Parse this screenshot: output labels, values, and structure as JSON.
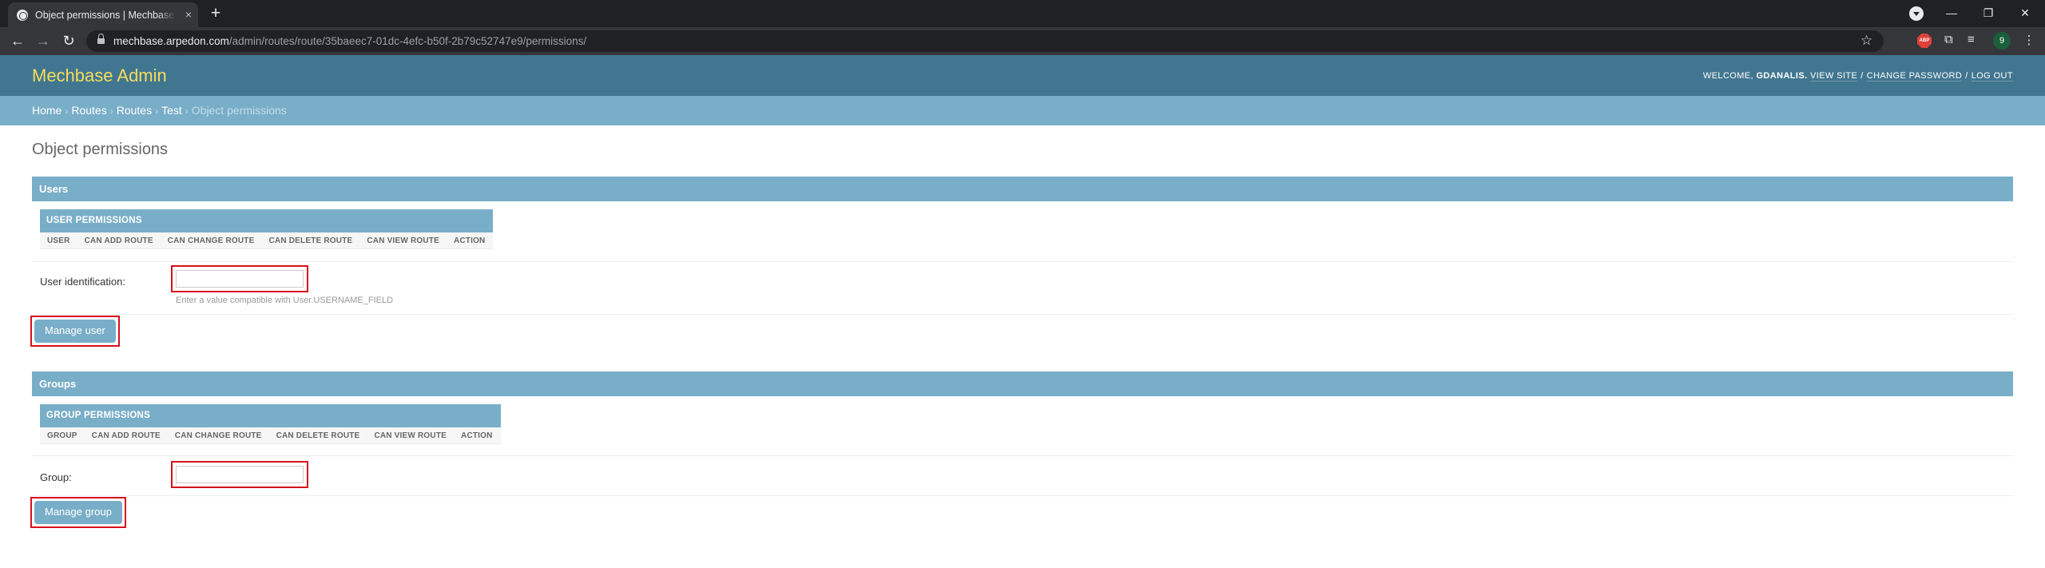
{
  "browser": {
    "tab_title": "Object permissions | Mechbase Admin",
    "new_tab_glyph": "+",
    "url_host": "mechbase.arpedon.com",
    "url_path": "/admin/routes/route/35baeec7-01dc-4efc-b50f-2b79c52747e9/permissions/",
    "profile_initial": "9",
    "abp_label": "ABP",
    "window_controls": {
      "minimize": "—",
      "restore": "❐",
      "close": "✕"
    },
    "nav": {
      "back": "←",
      "forward": "→",
      "reload": "↻"
    },
    "icons": [
      "globe-icon",
      "lock-icon",
      "star-icon",
      "adblock-plus-icon",
      "puzzle-icon",
      "media-queue-icon",
      "kebab-menu-icon"
    ]
  },
  "admin": {
    "site_title": "Mechbase Admin",
    "user_tools": {
      "welcome": "WELCOME,",
      "username": "GDANALIS.",
      "view_site": "VIEW SITE",
      "change_password": "CHANGE PASSWORD",
      "log_out": "LOG OUT",
      "separator": "/"
    },
    "breadcrumbs": [
      "Home",
      "Routes",
      "Routes",
      "Test",
      "Object permissions"
    ],
    "breadcrumb_separator": "›",
    "page_title": "Object permissions",
    "users": {
      "caption": "Users",
      "table_caption": "USER PERMISSIONS",
      "columns": [
        "USER",
        "CAN ADD ROUTE",
        "CAN CHANGE ROUTE",
        "CAN DELETE ROUTE",
        "CAN VIEW ROUTE",
        "ACTION"
      ],
      "field_label": "User identification:",
      "field_value": "",
      "help_text": "Enter a value compatible with User.USERNAME_FIELD",
      "button": "Manage user"
    },
    "groups": {
      "caption": "Groups",
      "table_caption": "GROUP PERMISSIONS",
      "columns": [
        "GROUP",
        "CAN ADD ROUTE",
        "CAN CHANGE ROUTE",
        "CAN DELETE ROUTE",
        "CAN VIEW ROUTE",
        "ACTION"
      ],
      "field_label": "Group:",
      "field_value": "",
      "button": "Manage group"
    }
  },
  "colors": {
    "header": "#417690",
    "breadcrumbs": "#79aec8",
    "site_title": "#f5dd5d",
    "highlight": "#d6111c"
  }
}
